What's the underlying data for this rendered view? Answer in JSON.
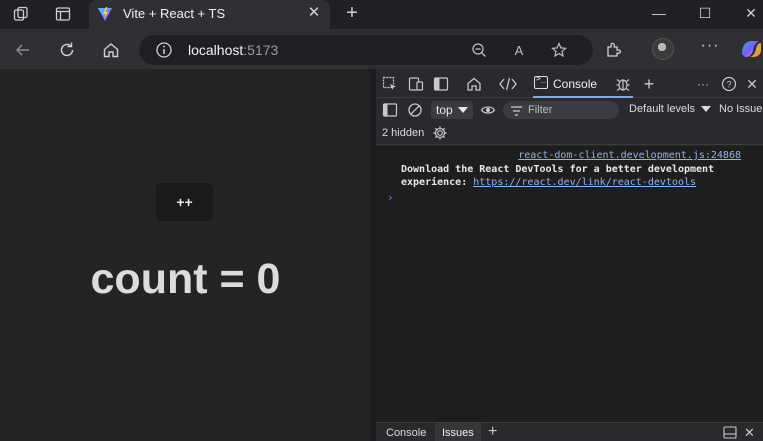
{
  "browser": {
    "tab": {
      "title": "Vite + React + TS",
      "close_glyph": "✕"
    },
    "new_tab_glyph": "+",
    "window_controls": {
      "minimize": "—",
      "maximize": "☐",
      "close": "✕"
    },
    "address": {
      "host": "localhost",
      "port": ":5173"
    },
    "icons": [
      "workspaces-icon",
      "tab-actions-icon",
      "vite-favicon",
      "back-icon",
      "refresh-icon",
      "home-icon",
      "site-info-icon",
      "zoom-icon",
      "read-aloud-icon",
      "favorite-star-icon",
      "extensions-icon",
      "profile-avatar",
      "more-menu-icon",
      "copilot-icon"
    ],
    "read_aloud_glyph": "A",
    "more_glyph": "···"
  },
  "page": {
    "button_label": "++",
    "count_text": "count = 0"
  },
  "devtools": {
    "tabs": {
      "console": "Console"
    },
    "more_glyph": "···",
    "help_glyph": "?",
    "close_glyph": "✕",
    "toolbar": {
      "context": "top",
      "filter_placeholder": "Filter",
      "levels": "Default levels",
      "issues": "No Issues"
    },
    "hidden_count": "2 hidden",
    "console": {
      "source": "react-dom-client.development.js:24868",
      "message": "Download the React DevTools for a better development experience: ",
      "link": "https://react.dev/link/react-devtools",
      "prompt": "›"
    },
    "drawer": {
      "tabs": [
        "Console",
        "Issues"
      ],
      "active": "Issues",
      "add_glyph": "+"
    }
  }
}
